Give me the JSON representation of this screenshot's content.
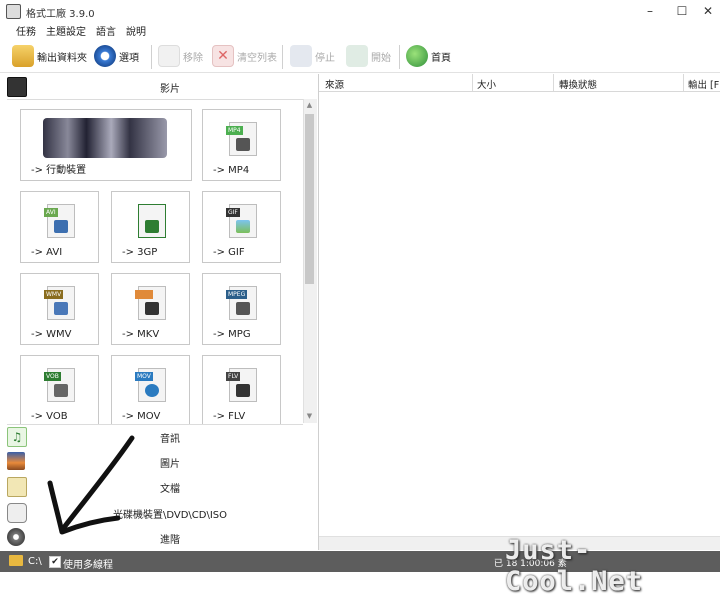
{
  "window": {
    "title": "格式工廠 3.9.0",
    "minimize": "–",
    "maximize": "☐",
    "close": "✕"
  },
  "menu": [
    "任務",
    "主題設定",
    "語言",
    "說明"
  ],
  "toolbar": {
    "output_folder": "輸出資料夾",
    "options": "選項",
    "remove": "移除",
    "clear_list": "清空列表",
    "stop": "停止",
    "start": "開始",
    "home": "首頁"
  },
  "left": {
    "video_header": "影片",
    "video_tiles": [
      {
        "label": "-> 行動裝置"
      },
      {
        "label": "-> MP4",
        "tag": "MP4",
        "tag_color": "#4caf50"
      },
      {
        "label": "-> AVI",
        "tag": "AVI",
        "tag_color": "#6aa84f"
      },
      {
        "label": "-> 3GP",
        "tag": "",
        "tag_color": "#2e7d32"
      },
      {
        "label": "-> GIF",
        "tag": "GIF",
        "tag_color": "#333333"
      },
      {
        "label": "-> WMV",
        "tag": "WMV",
        "tag_color": "#8a6d1f"
      },
      {
        "label": "-> MKV",
        "tag": "",
        "tag_color": "#e08a3a"
      },
      {
        "label": "-> MPG",
        "tag": "MPEG",
        "tag_color": "#2c5f8a"
      },
      {
        "label": "-> VOB",
        "tag": "VOB",
        "tag_color": "#2e7d32"
      },
      {
        "label": "-> MOV",
        "tag": "MOV",
        "tag_color": "#2b7bc0"
      },
      {
        "label": "-> FLV",
        "tag": "FLV",
        "tag_color": "#444444"
      }
    ],
    "categories": [
      "音訊",
      "圖片",
      "文檔",
      "光碟機裝置\\DVD\\CD\\ISO",
      "進階"
    ]
  },
  "list": {
    "columns": [
      "來源",
      "大小",
      "轉換狀態",
      "輸出 [F"
    ]
  },
  "status": {
    "path": "C:\\",
    "multithread_checked": "✔",
    "multithread_label": "使用多線程",
    "right_text": "已    18        1:00:06            素"
  },
  "watermark": "Just-Cool.Net",
  "colors": {
    "accent_blue": "#2b7bc0",
    "status_bar": "#5d5d5d"
  }
}
